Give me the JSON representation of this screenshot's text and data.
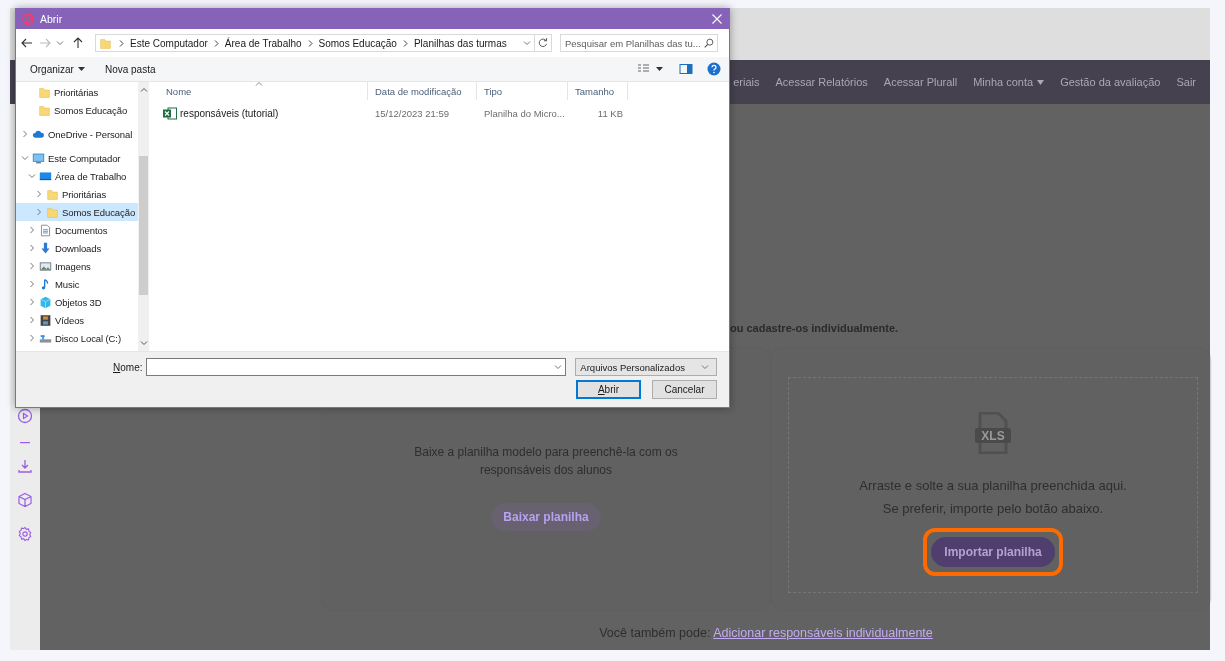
{
  "page": {
    "nav_items": [
      {
        "label": "eriais",
        "dropdown": false
      },
      {
        "label": "Acessar Relatórios",
        "dropdown": false
      },
      {
        "label": "Acessar Plurall",
        "dropdown": false
      },
      {
        "label": "Minha conta",
        "dropdown": true
      },
      {
        "label": "Gestão da avaliação",
        "dropdown": false
      },
      {
        "label": "Sair",
        "dropdown": false
      }
    ],
    "intro_text": "ou cadastre-os individualmente.",
    "download_card": {
      "text": "Baixe a planilha modelo para preenchê-la com os responsáveis dos alunos",
      "button": "Baixar planilha"
    },
    "upload_card": {
      "file_badge": "XLS",
      "line_1": "Arraste e solte a sua planilha preenchida aqui.",
      "line_2": "Se preferir, importe pelo botão abaixo.",
      "button": "Importar planilha",
      "highlighted": true
    },
    "footer_text": "Você também pode:",
    "footer_link": "Adicionar responsáveis individualmente"
  },
  "dialog": {
    "title": "Abrir",
    "breadcrumb": [
      "Este Computador",
      "Área de Trabalho",
      "Somos Educação",
      "Planilhas das turmas"
    ],
    "search": {
      "placeholder": "Pesquisar em Planilhas das tu..."
    },
    "toolbar": {
      "organize": "Organizar",
      "new_folder": "Nova pasta"
    },
    "nav_tree": [
      {
        "label": "Prioritárias",
        "kind": "folder",
        "selected": false
      },
      {
        "label": "Somos Educação",
        "kind": "folder",
        "selected": false
      },
      {
        "label": "OneDrive - Personal",
        "kind": "cloud",
        "selected": false,
        "expanded": false
      },
      {
        "label": "Este Computador",
        "kind": "computer",
        "selected": false,
        "expanded": true,
        "children": [
          {
            "label": "Área de Trabalho",
            "kind": "desktop",
            "selected": false,
            "expanded": true,
            "children": [
              {
                "label": "Prioritárias",
                "kind": "folder",
                "selected": false,
                "expanded": false
              },
              {
                "label": "Somos Educação",
                "kind": "folder",
                "selected": true,
                "expanded": false
              }
            ]
          },
          {
            "label": "Documentos",
            "kind": "document",
            "selected": false,
            "expanded": false
          },
          {
            "label": "Downloads",
            "kind": "download",
            "selected": false,
            "expanded": false
          },
          {
            "label": "Imagens",
            "kind": "image",
            "selected": false,
            "expanded": false
          },
          {
            "label": "Music",
            "kind": "music",
            "selected": false,
            "expanded": false
          },
          {
            "label": "Objetos 3D",
            "kind": "cube",
            "selected": false,
            "expanded": false
          },
          {
            "label": "Vídeos",
            "kind": "film",
            "selected": false,
            "expanded": false
          },
          {
            "label": "Disco Local (C:)",
            "kind": "disk",
            "selected": false,
            "expanded": false
          }
        ]
      }
    ],
    "columns": [
      "Nome",
      "Data de modificação",
      "Tipo",
      "Tamanho"
    ],
    "files": [
      {
        "name": "responsáveis (tutorial)",
        "modified": "15/12/2023 21:59",
        "type": "Planilha do Micro...",
        "size": "11 KB",
        "selected": false
      }
    ],
    "name_label": "Nome:",
    "filter": "Arquivos Personalizados",
    "open_button": "Abrir",
    "cancel_button": "Cancelar"
  }
}
